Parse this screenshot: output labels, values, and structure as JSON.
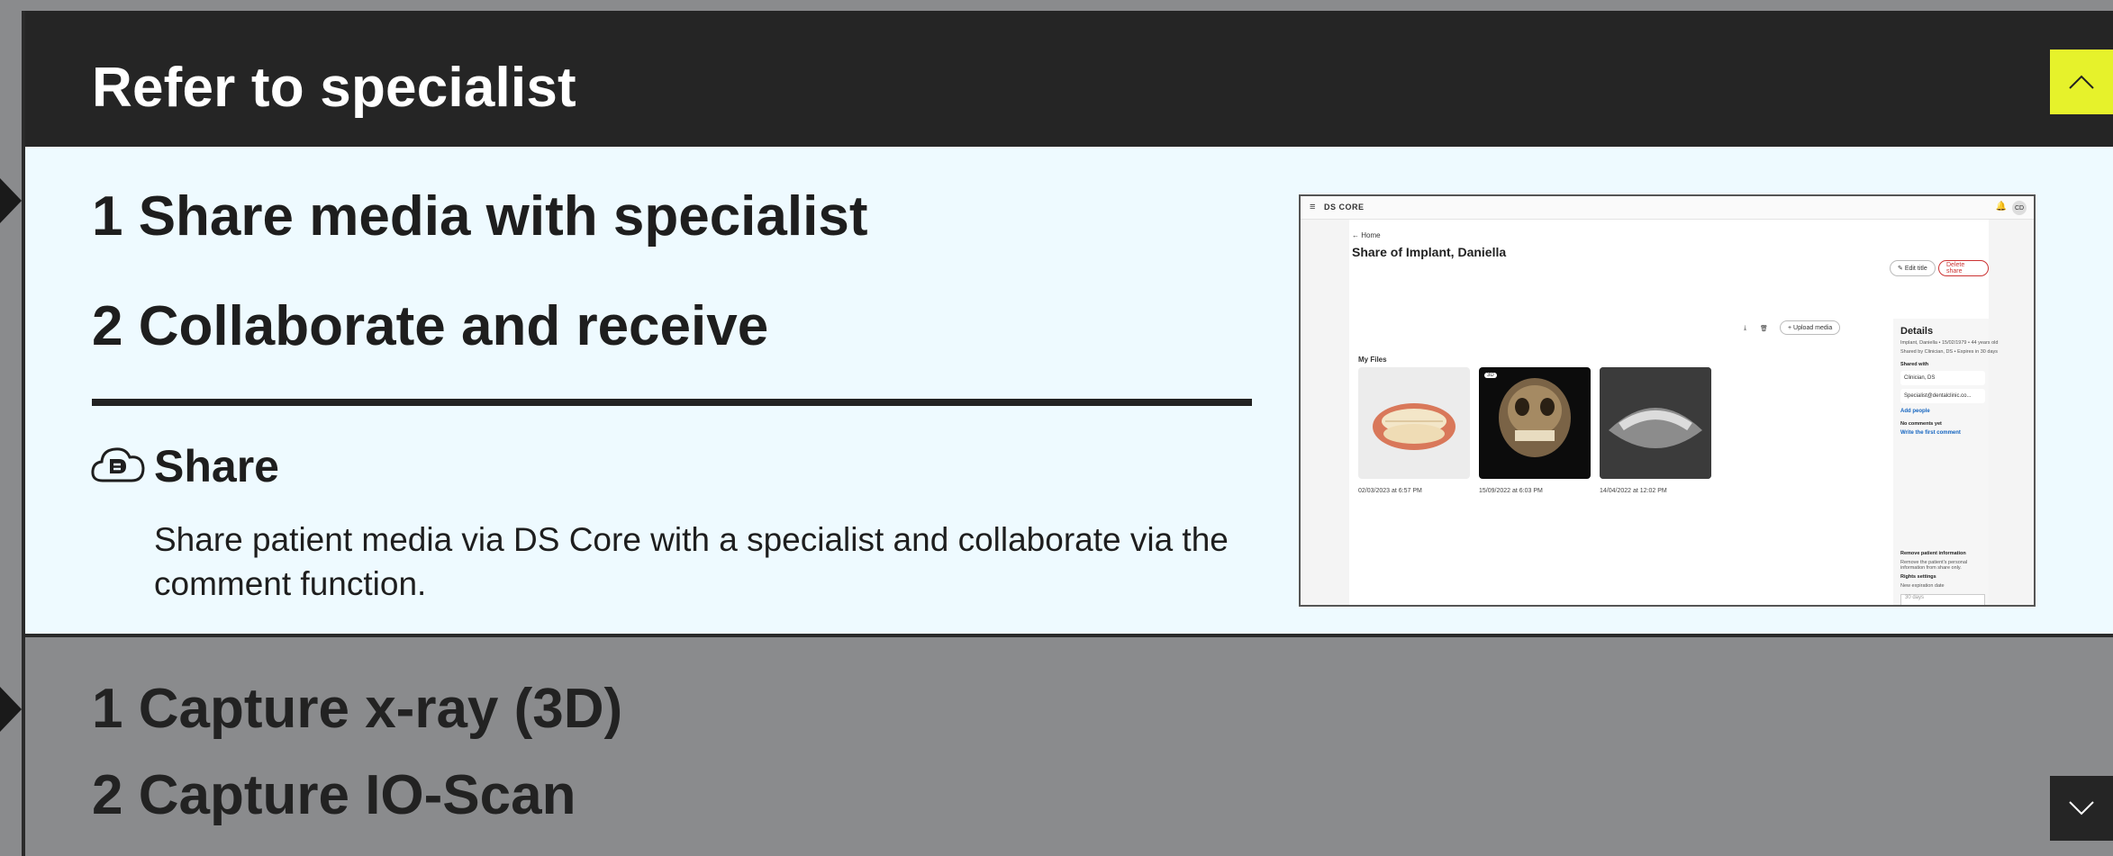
{
  "header": {
    "title": "Refer to specialist"
  },
  "panel": {
    "steps": [
      "1 Share media with specialist",
      "2 Collaborate and receive"
    ],
    "section_title": "Share",
    "section_text": "Share patient media via DS Core with a specialist and collaborate via the comment function."
  },
  "collapsed": {
    "steps": [
      "1 Capture x-ray (3D)",
      "2 Capture IO-Scan"
    ]
  },
  "preview": {
    "brand": "DS CORE",
    "avatar": "CD",
    "back": "Home",
    "title": "Share of Implant, Daniella",
    "edit": "Edit title",
    "delete": "Delete share",
    "upload": "Upload media",
    "my_files": "My Files",
    "thumb_badge": "3D",
    "dates": [
      "02/03/2023 at 6:57 PM",
      "15/09/2022 at 6:03 PM",
      "14/04/2022 at 12:02 PM"
    ],
    "details": {
      "title": "Details",
      "line1": "Implant, Daniella • 15/02/1979 • 44 years old",
      "line2": "Shared by Clinician, DS • Expires in 30 days",
      "shared_with": "Shared with",
      "person1": "Clinician, DS",
      "person2": "Specialist@dentalclinic.co...",
      "add_people": "Add people",
      "no_comments": "No comments yet",
      "write_comment": "Write the first comment",
      "remove_info": "Remove patient information",
      "remove_desc": "Remove the patient's personal information from share only.",
      "rights": "Rights settings",
      "expiration": "New expiration date",
      "select": "30 days"
    }
  },
  "colors": {
    "accent": "#e6f22b",
    "dark": "#252525",
    "panel": "#eefaff",
    "gray": "#8a8b8d"
  }
}
